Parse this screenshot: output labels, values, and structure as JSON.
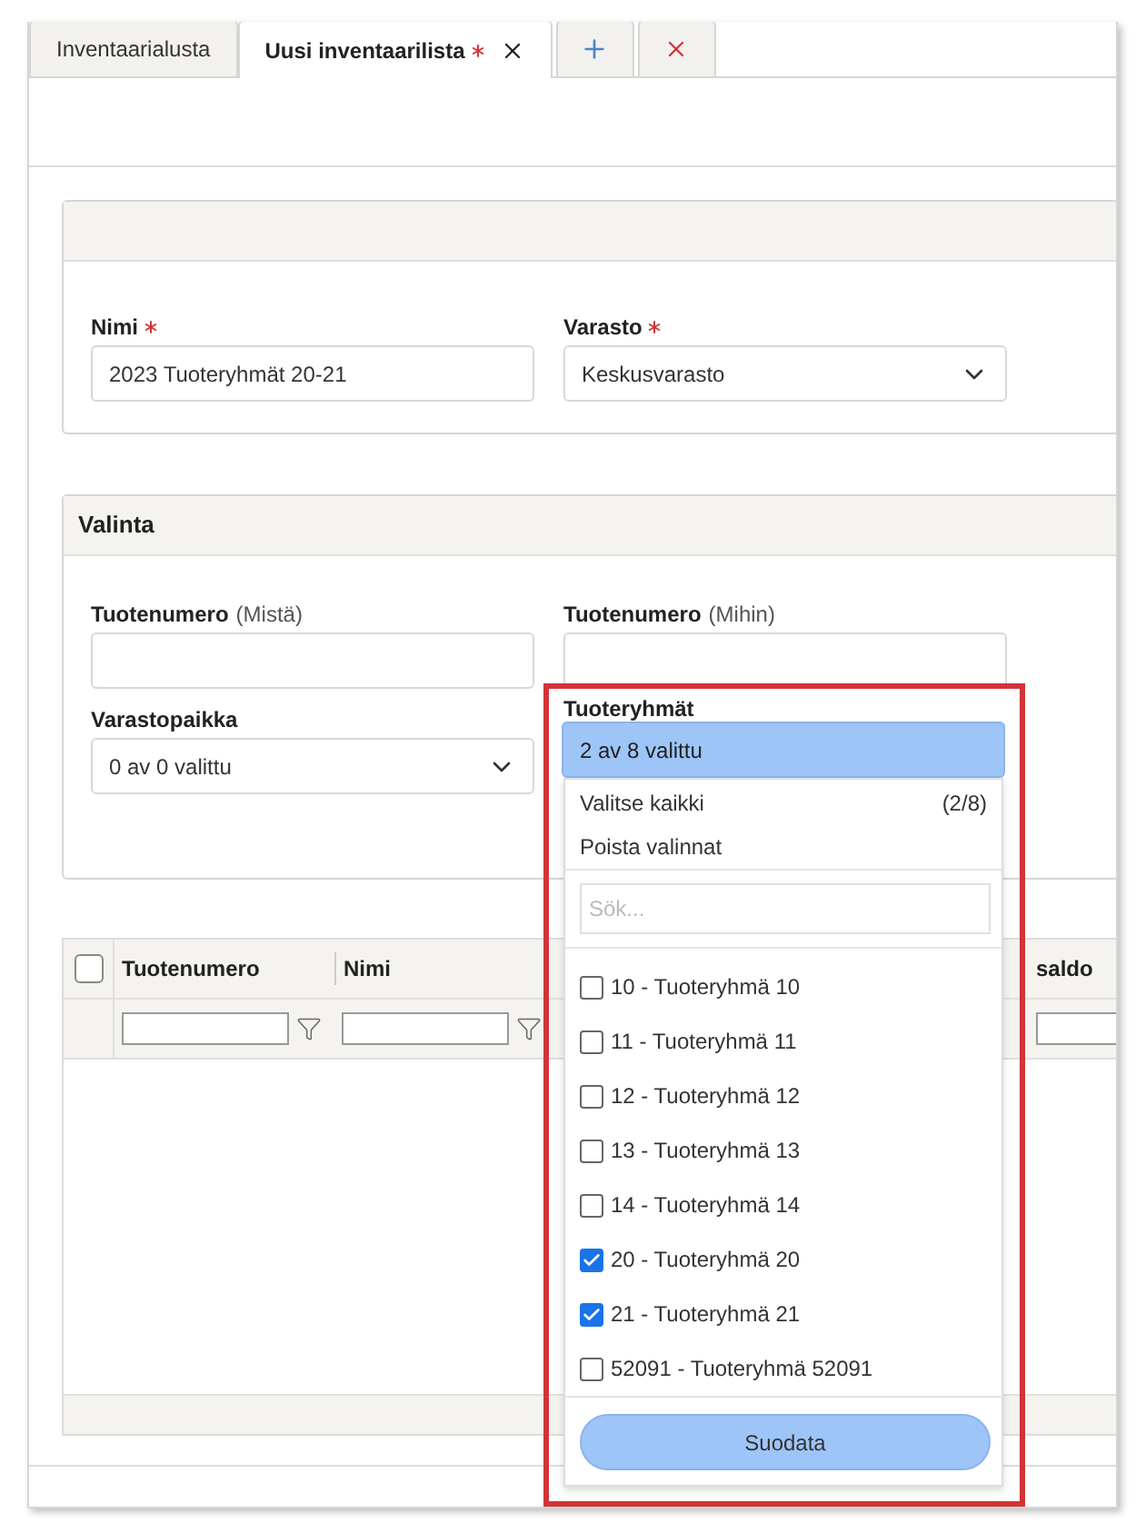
{
  "tabs": [
    {
      "label": "Inventaarialusta",
      "selected": false,
      "required": false,
      "closable": false
    },
    {
      "label": "Uusi inventaarilista",
      "selected": true,
      "required": true,
      "closable": true
    }
  ],
  "tab_actions": [
    {
      "kind": "add"
    },
    {
      "kind": "close"
    }
  ],
  "main_form": {
    "fields": [
      {
        "label": "Nimi",
        "required": true,
        "kind": "text",
        "value": "2023 Tuoteryhmät 20-21"
      },
      {
        "label": "Varasto",
        "required": true,
        "kind": "select",
        "value": "Keskusvarasto"
      }
    ]
  },
  "selection": {
    "title": "Valinta",
    "fields": [
      {
        "label": "Tuotenumero",
        "hint": "(Mistä)",
        "kind": "text"
      },
      {
        "label": "Tuotenumero",
        "hint": "(Mihin)",
        "kind": "text"
      },
      {
        "label": "Varastopaikka",
        "kind": "select",
        "value": "0 av 0 valittu"
      }
    ]
  },
  "product_groups": {
    "label": "Tuoteryhmät",
    "value": "2 av 8 valittu",
    "select_all": "Valitse kaikki",
    "count": "(2/8)",
    "clear": "Poista valinnat",
    "search": {
      "placeholder": "Sök..."
    },
    "options": [
      {
        "label": "10 - Tuoteryhmä 10",
        "checked": false
      },
      {
        "label": "11 - Tuoteryhmä 11",
        "checked": false
      },
      {
        "label": "12 - Tuoteryhmä 12",
        "checked": false
      },
      {
        "label": "13 - Tuoteryhmä 13",
        "checked": false
      },
      {
        "label": "14 - Tuoteryhmä 14",
        "checked": false
      },
      {
        "label": "20 - Tuoteryhmä 20",
        "checked": true
      },
      {
        "label": "21 - Tuoteryhmä 21",
        "checked": true
      },
      {
        "label": "52091 - Tuoteryhmä 52091",
        "checked": false
      }
    ],
    "button": "Suodata"
  },
  "table": {
    "select_all_checked": false,
    "columns": [
      {
        "label": "Tuotenumero",
        "filter": true,
        "filter_icon": true
      },
      {
        "label": "Nimi",
        "filter": true,
        "filter_icon": true
      },
      {
        "label": "saldo",
        "filter": true,
        "filter_icon": false
      }
    ]
  }
}
